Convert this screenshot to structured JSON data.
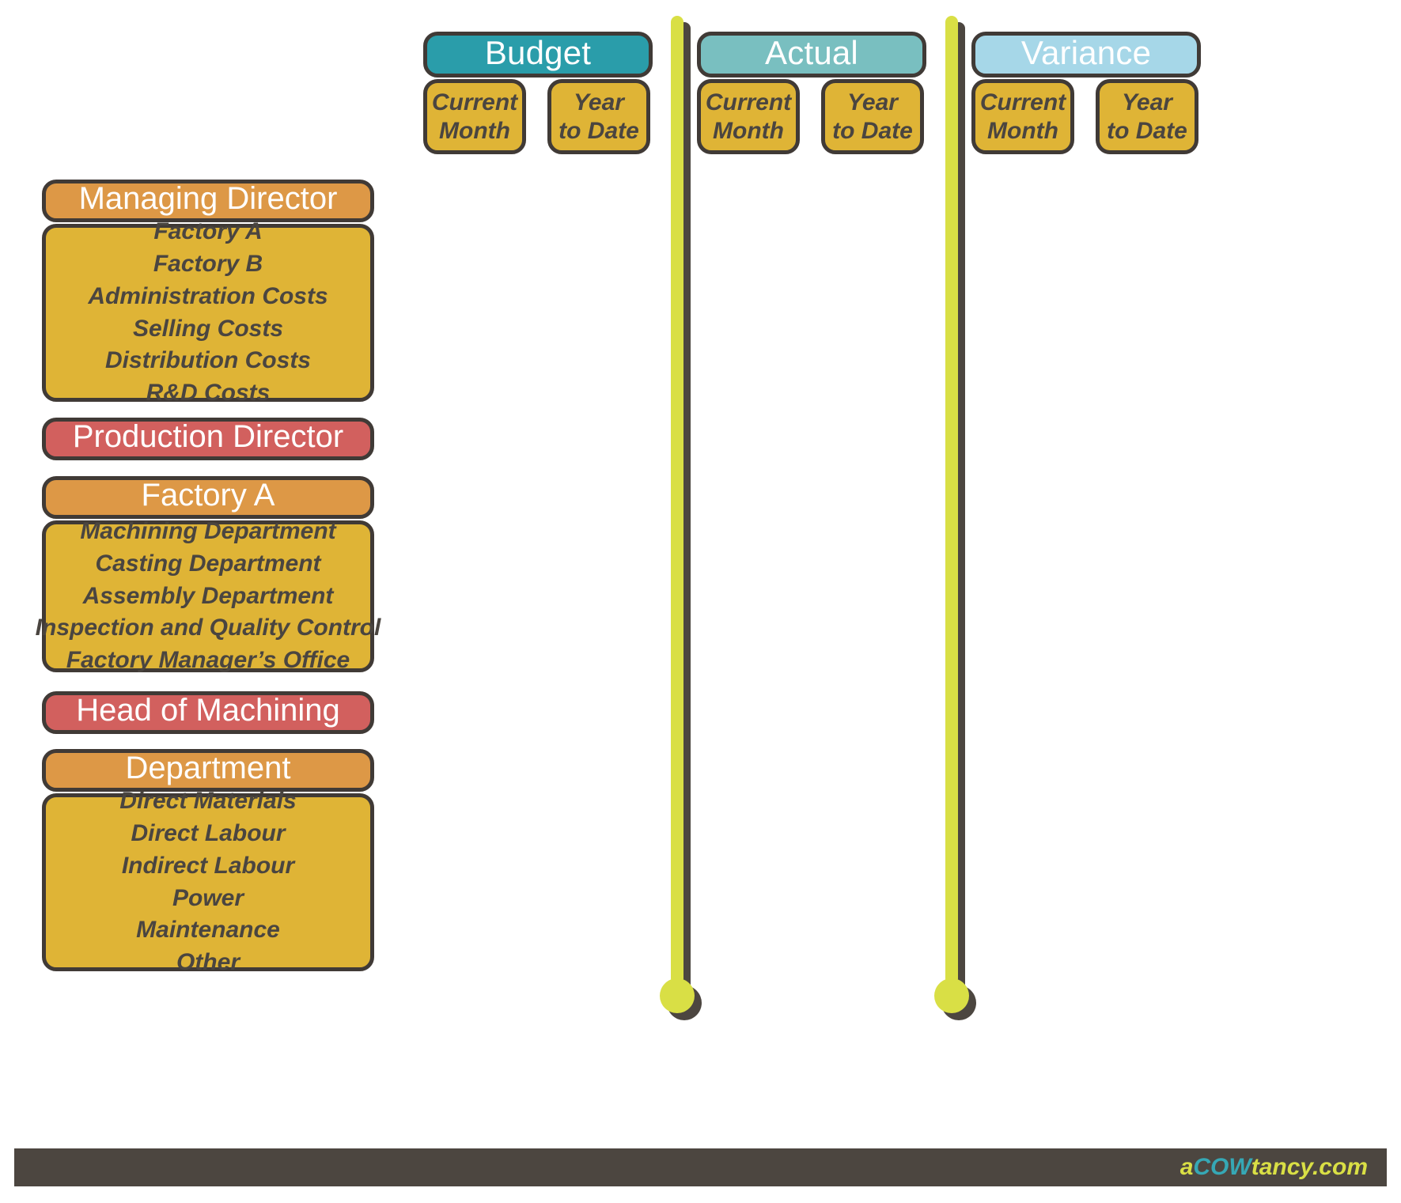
{
  "columns": [
    {
      "title": "Budget",
      "color": "#2a9daa",
      "sub": [
        {
          "line1": "Current",
          "line2": "Month"
        },
        {
          "line1": "Year",
          "line2": "to Date"
        }
      ]
    },
    {
      "title": "Actual",
      "color": "#79bfc0",
      "sub": [
        {
          "line1": "Current",
          "line2": "Month"
        },
        {
          "line1": "Year",
          "line2": "to Date"
        }
      ]
    },
    {
      "title": "Variance",
      "color": "#a6d7e8",
      "sub": [
        {
          "line1": "Current",
          "line2": "Month"
        },
        {
          "line1": "Year",
          "line2": "to Date"
        }
      ]
    }
  ],
  "hierarchy": [
    {
      "header": "Managing Director",
      "header_color": "#dd9846",
      "items": [
        "Factory A",
        "Factory B",
        "Administration Costs",
        "Selling Costs",
        "Distribution Costs",
        "R&D Costs"
      ]
    },
    {
      "header": "Production Director",
      "header_color": "#d2605e",
      "items": []
    },
    {
      "header": "Factory A",
      "header_color": "#dd9846",
      "items": [
        "Machining Department",
        "Casting Department",
        "Assembly Department",
        "Inspection and Quality Control",
        "Factory Manager’s Office"
      ]
    },
    {
      "header": "Head of Machining",
      "header_color": "#d2605e",
      "items": []
    },
    {
      "header": "Department",
      "header_color": "#dd9846",
      "items": [
        "Direct Materials",
        "Direct Labour",
        "Indirect Labour",
        "Power",
        "Maintenance",
        "Other"
      ]
    }
  ],
  "footer": {
    "logo_part_1": "a",
    "logo_part_2": "COW",
    "logo_part_3": "tancy.com",
    "logo_color_green": "#d9df45",
    "logo_color_teal": "#36a8b5",
    "bar_color": "#4c4640"
  },
  "pins": {
    "color": "#d9df45",
    "shadow_color": "#4c4640",
    "count": 2
  }
}
